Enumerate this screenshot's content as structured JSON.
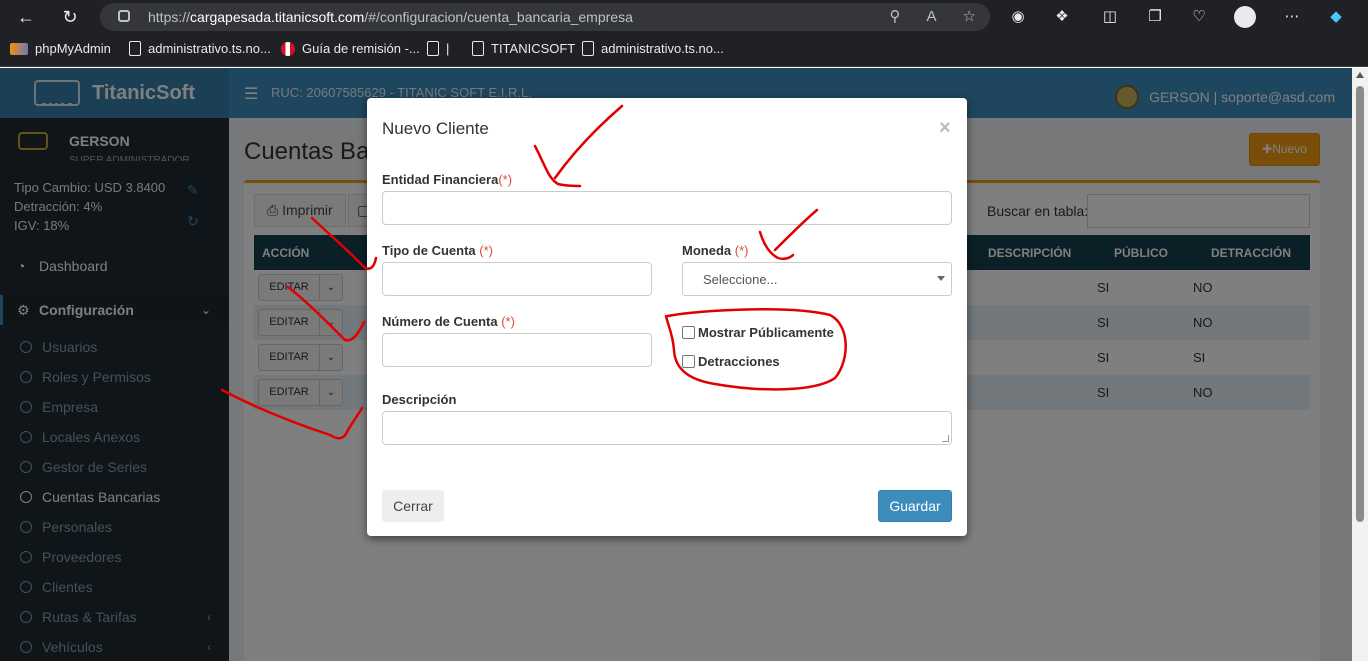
{
  "browser": {
    "url_host": "cargapesada.titanicsoft.com",
    "url_path": "/#/configuracion/cuenta_bancaria_empresa",
    "url_scheme": "https://",
    "bookmarks": [
      {
        "label": "phpMyAdmin",
        "icon": "phpmyadmin-icon"
      },
      {
        "label": "administrativo.ts.no...",
        "icon": "page-icon"
      },
      {
        "label": "Guía de remisión -...",
        "icon": "peru-flag-icon"
      },
      {
        "label": "|",
        "icon": "page-icon"
      },
      {
        "label": "TITANICSOFT",
        "icon": "page-icon"
      },
      {
        "label": "administrativo.ts.no...",
        "icon": "page-icon"
      }
    ]
  },
  "header": {
    "brand": "TitanicSoft",
    "ruc": "RUC: 20607585629 - TITANIC SOFT E.I.R.L.",
    "user": "GERSON | soporte@asd.com"
  },
  "sidebar": {
    "user_name": "GERSON",
    "user_role": "SUPER ADMINISTRADOR",
    "tipo_cambio": "Tipo Cambio: USD 3.8400",
    "detraccion": "Detracción: 4%",
    "igv": "IGV: 18%",
    "dashboard": "Dashboard",
    "configuracion": "Configuración",
    "items": [
      {
        "label": "Usuarios"
      },
      {
        "label": "Roles y Permisos"
      },
      {
        "label": "Empresa"
      },
      {
        "label": "Locales Anexos"
      },
      {
        "label": "Gestor de Series"
      },
      {
        "label": "Cuentas Bancarias"
      },
      {
        "label": "Personales"
      },
      {
        "label": "Proveedores"
      },
      {
        "label": "Clientes"
      },
      {
        "label": "Rutas & Tarifas"
      },
      {
        "label": "Vehículos"
      }
    ]
  },
  "content": {
    "title": "Cuentas Bancarias",
    "nuevo": "Nuevo",
    "imprimir": "Imprimir",
    "search_label": "Buscar en tabla:",
    "columns": {
      "accion": "ACCIÓN",
      "descripcion": "DESCRIPCIÓN",
      "publico": "PÚBLICO",
      "detraccion": "DETRACCIÓN"
    },
    "rows": [
      {
        "edit": "EDITAR",
        "publico": "SI",
        "detraccion": "NO"
      },
      {
        "edit": "EDITAR",
        "publico": "SI",
        "detraccion": "NO"
      },
      {
        "edit": "EDITAR",
        "publico": "SI",
        "detraccion": "SI"
      },
      {
        "edit": "EDITAR",
        "publico": "SI",
        "detraccion": "NO"
      }
    ]
  },
  "modal": {
    "title": "Nuevo Cliente",
    "close": "×",
    "entidad_label": "Entidad Financiera",
    "tipo_label": "Tipo de Cuenta ",
    "moneda_label": "Moneda ",
    "numero_label": "Número de Cuenta ",
    "descripcion_label": "Descripción",
    "required": "(*)",
    "moneda_value": "Seleccione...",
    "mostrar_label": "Mostrar Públicamente",
    "detracciones_label": "Detracciones",
    "entidad_value": "",
    "tipo_value": "",
    "numero_value": "",
    "descripcion_value": "",
    "mostrar_checked": false,
    "detracciones_checked": false,
    "cerrar": "Cerrar",
    "guardar": "Guardar"
  }
}
